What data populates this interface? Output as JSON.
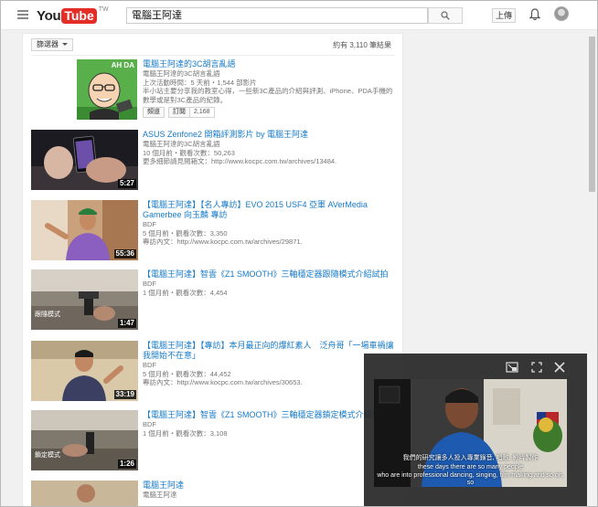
{
  "header": {
    "logo_you": "You",
    "logo_tube": "Tube",
    "logo_region": "TW",
    "search_value": "電腦王阿達",
    "upload_label": "上傳"
  },
  "filter": {
    "label": "篩選器",
    "result_count": "約有 3,110 筆結果"
  },
  "results": [
    {
      "type": "channel",
      "thumb_text": "AH DA",
      "title": "電腦王阿達的3C胡言亂語",
      "channel": "電腦王阿達的3C胡言亂語",
      "meta": "上次活動時間：5 天前・1,544 部影片",
      "desc": "半小站主要分享我的教室心得，一些新3C產品的介紹與評測、iPhone、PDA手機的數學或是對3C產品的紀錄。",
      "btn_channel": "頻道",
      "btn_subscribe": "訂閱",
      "subscriber_count": "2,168"
    },
    {
      "type": "video",
      "duration": "5:27",
      "title": "ASUS Zenfone2 開箱評測影片 by 電腦王阿達",
      "channel": "電腦王阿達的3C胡言亂語",
      "meta": "10 個月前・觀看次數：50,263",
      "desc": "更多細節請見閱箱文：http://www.kocpc.com.tw/archives/13484."
    },
    {
      "type": "video",
      "duration": "55:36",
      "title": "【電腦王阿達】【名人專訪】EVO 2015 USF4 亞軍 AVerMedia Gamerbee 向玉麟 專訪",
      "channel": "BDF",
      "meta": "5 個月前・觀看次數：3,350",
      "desc": "專訪內文：http://www.kocpc.com.tw/archives/29871."
    },
    {
      "type": "video",
      "duration": "1:47",
      "thumb_caption": "跟隨模式",
      "title": "【電腦王阿達】智雲《Z1 SMOOTH》三軸穩定器跟隨模式介紹試拍",
      "channel": "BDF",
      "meta": "1 個月前・觀看次數：4,454",
      "desc": ""
    },
    {
      "type": "video",
      "duration": "33:19",
      "title": "【電腦王阿達】【專訪】本月最正向的爆紅素人　泛舟哥「一場車禍讓我開始不在意」",
      "channel": "BDF",
      "meta": "5 個月前・觀看次數：44,452",
      "desc": "專訪內文：http://www.kocpc.com.tw/archives/30653."
    },
    {
      "type": "video",
      "duration": "1:26",
      "thumb_caption": "鎖定模式",
      "title": "【電腦王阿達】智雲《Z1 SMOOTH》三軸穩定器鎖定模式介紹試拍",
      "channel": "BDF",
      "meta": "1 個月前・觀看次數：3,108",
      "desc": ""
    },
    {
      "type": "video",
      "duration": "",
      "title": "電腦王阿達",
      "channel": "電腦王阿達",
      "meta": "",
      "desc": ""
    }
  ],
  "mini_player": {
    "subtitle_zh": "我們的研究讓多人投入專業錄音, 唱歌, 影片製作",
    "subtitle_en1": "these days there are so many people",
    "subtitle_en2": "who are into professional dancing, singing, film making and so on. so"
  },
  "colors": {
    "link_blue": "#167ac6",
    "youtube_red": "#e52d27",
    "meta_gray": "#767676"
  }
}
